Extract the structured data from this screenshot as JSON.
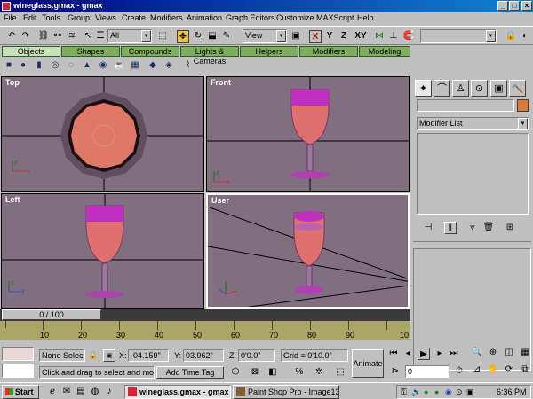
{
  "window": {
    "title": "wineglass.gmax - gmax",
    "controls": [
      "_",
      "□",
      "×"
    ]
  },
  "menu": [
    "File",
    "Edit",
    "Tools",
    "Group",
    "Views",
    "Create",
    "Modifiers",
    "Animation",
    "Graph Editors",
    "Customize",
    "MAXScript",
    "Help"
  ],
  "toolbar": {
    "selection_filter": "All",
    "coord_system": "View",
    "axis_x": "X",
    "axis_y": "Y",
    "axis_z": "Z",
    "axis_xy": "XY"
  },
  "tabs": [
    "Objects",
    "Shapes",
    "Compounds",
    "Lights & Cameras",
    "Helpers",
    "Modifiers",
    "Modeling"
  ],
  "active_tab": "Objects",
  "viewports": {
    "top": "Top",
    "front": "Front",
    "left": "Left",
    "user": "User"
  },
  "command_panel": {
    "modifier_list": "Modifier List"
  },
  "timeline": {
    "frame_display": "0 / 100",
    "frame_fraction": 0,
    "ticks": [
      "10",
      "20",
      "30",
      "40",
      "50",
      "60",
      "70",
      "80",
      "90",
      "10"
    ]
  },
  "status": {
    "selection": "None Select",
    "prompt": "Click and drag to select and move o",
    "add_time_tag": "Add Time Tag",
    "x_label": "X:",
    "x_value": "-04.159\"",
    "y_label": "Y:",
    "y_value": "03.962\"",
    "z_label": "Z:",
    "z_value": "0'0.0\"",
    "grid": "Grid = 0'10.0\"",
    "animate": "Animate",
    "frame_value": "0"
  },
  "taskbar": {
    "start": "Start",
    "task1": "wineglass.gmax - gmax",
    "task2": "Paint Shop Pro - Image13",
    "clock": "6:36 PM"
  },
  "colors": {
    "title_left": "#000080",
    "title_right": "#1084d0",
    "viewport_bg": "#7f6f7f",
    "glass": "#e07070",
    "rim": "#c030c0",
    "tab_green": "#7fae5d",
    "track": "#aaa664"
  }
}
